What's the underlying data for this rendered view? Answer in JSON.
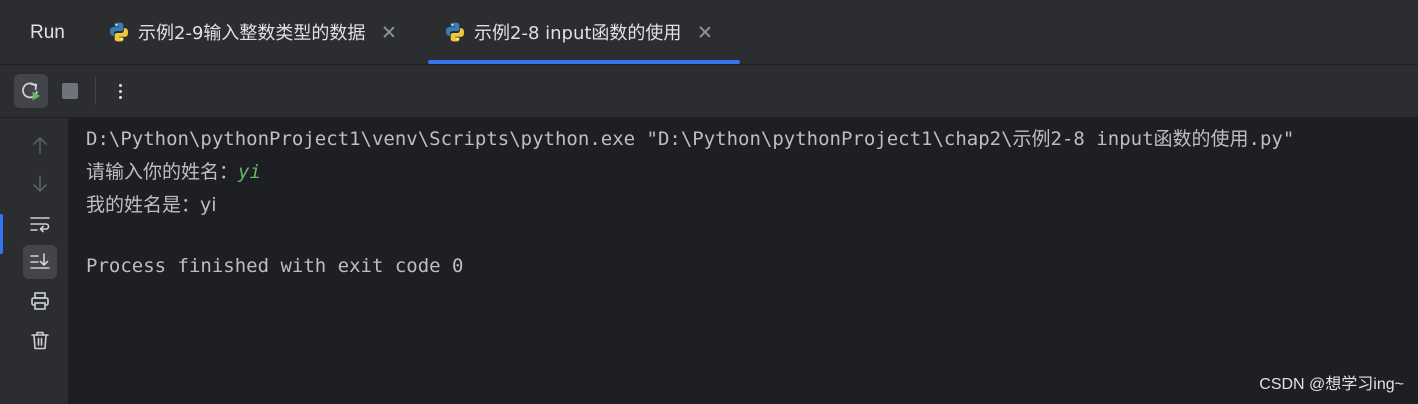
{
  "header": {
    "title": "Run",
    "tabs": [
      {
        "label": "示例2-9输入整数类型的数据",
        "active": false
      },
      {
        "label": "示例2-8 input函数的使用",
        "active": true
      }
    ]
  },
  "colors": {
    "accent": "#3574f0",
    "background": "#1e1f22",
    "panel": "#2b2d30",
    "text": "#bcbec4",
    "input_text": "#5fb865"
  },
  "toolbar": {
    "icons": [
      "rerun-icon",
      "stop-icon",
      "more-icon"
    ]
  },
  "gutter": {
    "icons": [
      "arrow-up-icon",
      "arrow-down-icon",
      "soft-wrap-icon",
      "scroll-to-end-icon",
      "print-icon",
      "trash-icon"
    ]
  },
  "console": {
    "command": "D:\\Python\\pythonProject1\\venv\\Scripts\\python.exe \"D:\\Python\\pythonProject1\\chap2\\示例2-8 input函数的使用.py\"",
    "prompt": "请输入你的姓名：",
    "input_value": "yi",
    "output": "我的姓名是：yi",
    "exit_message": "Process finished with exit code 0"
  },
  "watermark": "CSDN @想学习ing~"
}
